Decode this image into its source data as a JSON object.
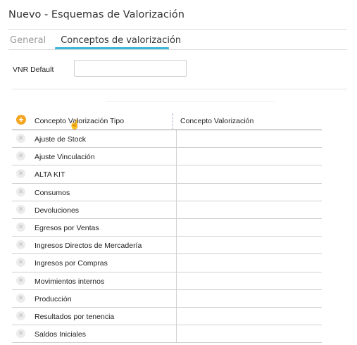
{
  "window": {
    "title": "Nuevo - Esquemas de Valorización"
  },
  "tabs": [
    {
      "label": "General",
      "active": false
    },
    {
      "label": "Conceptos de valorización",
      "active": true
    }
  ],
  "form": {
    "vnr_label": "VNR Default",
    "vnr_value": ""
  },
  "grid": {
    "add_icon": "plus-circle-icon",
    "columns": [
      "Concepto Valorización Tipo",
      "Concepto Valorización"
    ],
    "rows": [
      {
        "tipo": "Ajuste de Stock",
        "concepto": ""
      },
      {
        "tipo": "Ajuste Vinculación",
        "concepto": ""
      },
      {
        "tipo": "ALTA KIT",
        "concepto": ""
      },
      {
        "tipo": "Consumos",
        "concepto": ""
      },
      {
        "tipo": "Devoluciones",
        "concepto": ""
      },
      {
        "tipo": "Egresos por Ventas",
        "concepto": ""
      },
      {
        "tipo": "Ingresos Directos de Mercadería",
        "concepto": ""
      },
      {
        "tipo": "Ingresos por Compras",
        "concepto": ""
      },
      {
        "tipo": "Movimientos internos",
        "concepto": ""
      },
      {
        "tipo": "Producción",
        "concepto": ""
      },
      {
        "tipo": "Resultados por tenencia",
        "concepto": ""
      },
      {
        "tipo": "Saldos Iniciales",
        "concepto": ""
      }
    ]
  },
  "colors": {
    "accent": "#3ab6d8",
    "add_button": "#f5a623"
  }
}
